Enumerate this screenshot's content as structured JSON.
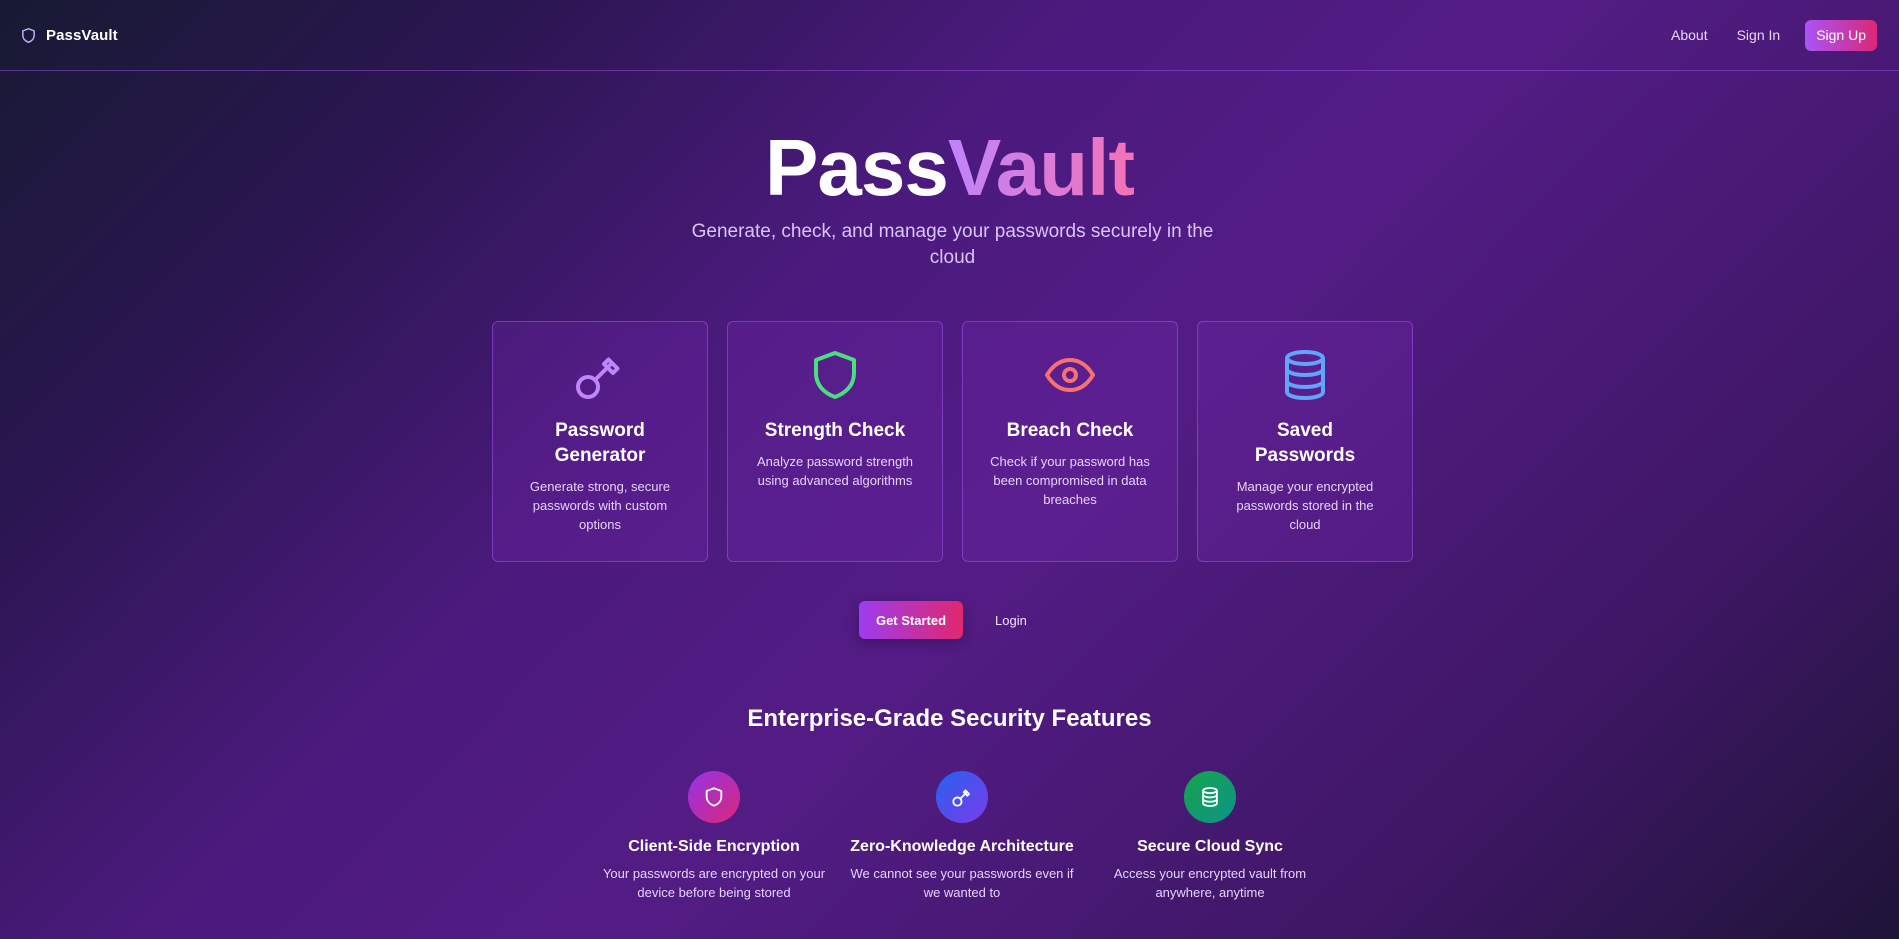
{
  "nav": {
    "brand": "PassVault",
    "brand_icon": "shield-icon",
    "links": [
      "About",
      "Sign In"
    ],
    "signup_label": "Sign Up"
  },
  "hero": {
    "title_part1": "Pass",
    "title_part2": "Vault",
    "subtitle": "Generate, check, and manage your passwords securely in the cloud"
  },
  "cards": [
    {
      "icon": "key-icon",
      "color": "#c084fc",
      "title": "Password Generator",
      "desc": "Generate strong, secure passwords with custom options"
    },
    {
      "icon": "shield-icon",
      "color": "#4ade80",
      "title": "Strength Check",
      "desc": "Analyze password strength using advanced algorithms"
    },
    {
      "icon": "eye-icon",
      "color": "#f87171",
      "title": "Breach Check",
      "desc": "Check if your password has been compromised in data breaches"
    },
    {
      "icon": "database-icon",
      "color": "#60a5fa",
      "title": "Saved Passwords",
      "desc": "Manage your encrypted passwords stored in the cloud"
    }
  ],
  "cta": {
    "primary_label": "Get Started",
    "secondary_label": "Login"
  },
  "features": {
    "title": "Enterprise-Grade Security Features",
    "items": [
      {
        "icon": "shield-icon",
        "gradient": [
          "#9333ea",
          "#db2777"
        ],
        "title": "Client-Side Encryption",
        "desc": "Your passwords are encrypted on your device before being stored"
      },
      {
        "icon": "key-icon",
        "gradient": [
          "#2563eb",
          "#7c3aed"
        ],
        "title": "Zero-Knowledge Architecture",
        "desc": "We cannot see your passwords even if we wanted to"
      },
      {
        "icon": "database-icon",
        "gradient": [
          "#16a34a",
          "#0d9488"
        ],
        "title": "Secure Cloud Sync",
        "desc": "Access your encrypted vault from anywhere, anytime"
      }
    ]
  },
  "colors": {
    "accent_purple": "#a855f7",
    "accent_pink": "#db2777"
  }
}
